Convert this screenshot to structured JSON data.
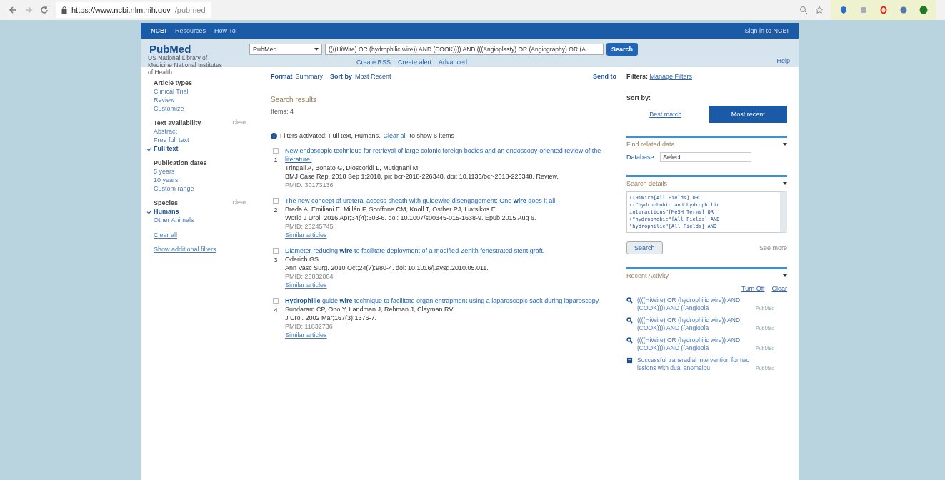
{
  "browser": {
    "url_host": "https://www.ncbi.nlm.nih.gov",
    "url_path": "/pubmed"
  },
  "ncbi_bar": {
    "brand": "NCBI",
    "links": [
      "Resources",
      "How To"
    ],
    "sign_in": "Sign in to NCBI"
  },
  "header": {
    "logo": "PubMed",
    "logo_sub": "US National Library of Medicine National Institutes of Health",
    "database": "PubMed",
    "query": "((((HiWire) OR (hydrophilic wire)) AND (COOK)))) AND (((Angioplasty) OR (Angiography) OR (A",
    "search_button": "Search",
    "links": [
      "Create RSS",
      "Create alert",
      "Advanced"
    ],
    "help": "Help"
  },
  "sidebar": {
    "groups": [
      {
        "title": "Article types",
        "items": [
          {
            "label": "Clinical Trial",
            "checked": false
          },
          {
            "label": "Review",
            "checked": false
          },
          {
            "label": "Customize",
            "checked": false
          }
        ]
      },
      {
        "title": "Text availability",
        "clear": "clear",
        "items": [
          {
            "label": "Abstract",
            "checked": false
          },
          {
            "label": "Free full text",
            "checked": false
          },
          {
            "label": "Full text",
            "checked": true
          }
        ]
      },
      {
        "title": "Publication dates",
        "items": [
          {
            "label": "5 years",
            "checked": false
          },
          {
            "label": "10 years",
            "checked": false
          },
          {
            "label": "Custom range",
            "checked": false
          }
        ]
      },
      {
        "title": "Species",
        "clear": "clear",
        "items": [
          {
            "label": "Humans",
            "checked": true
          },
          {
            "label": "Other Animals",
            "checked": false
          }
        ]
      }
    ],
    "links": [
      "Clear all",
      "Show additional filters"
    ]
  },
  "toolbar": {
    "format_label": "Format",
    "format": "Summary",
    "sort_label": "Sort by",
    "sort": "Most Recent",
    "send_to": "Send to"
  },
  "results": {
    "title": "Search results",
    "count": "Items: 4",
    "notice": "Filters activated: Full text, Humans.",
    "notice_link": "Clear all",
    "notice_tail": "to show 6 items",
    "items": [
      {
        "number": "1",
        "checked": false,
        "title": "New endoscopic technique for retrieval of large colonic foreign bodies and an endoscopy-oriented review of the literature.",
        "authors": "Tringali A, Bonato G, Dioscoridi L, Mutignani M.",
        "citation": "BMJ Case Rep. 2018 Sep 1;2018. pii: bcr-2018-226348. doi: 10.1136/bcr-2018-226348. Review.",
        "pmid": "PMID: 30173136"
      },
      {
        "number": "2",
        "checked": false,
        "title": "The new concept of ureteral access sheath with guidewire disengagement: One **wire** does it all.",
        "authors": "Breda A, Emiliani E, Millán F, Scoffone CM, Knoll T, Osther PJ, Liatsikos E.",
        "citation": "World J Urol. 2016 Apr;34(4):603-6. doi: 10.1007/s00345-015-1638-9. Epub 2015 Aug 6.",
        "pmid": "PMID: 26245745",
        "similar": "Similar articles"
      },
      {
        "number": "3",
        "checked": false,
        "title": "Diameter-reducing **wire** to facilitate deployment of a modified Zenith fenestrated stent graft.",
        "authors": "Oderich GS.",
        "citation": "Ann Vasc Surg. 2010 Oct;24(7):980-4. doi: 10.1016/j.avsg.2010.05.011.",
        "pmid": "PMID: 20832004",
        "similar": "Similar articles"
      },
      {
        "number": "4",
        "checked": false,
        "title": "**Hydrophilic** guide **wire** technique to facilitate organ entrapment using a laparoscopic sack during laparoscopy.",
        "authors": "Sundaram CP, Ono Y, Landman J, Rehman J, Clayman RV.",
        "citation": "J Urol. 2002 Mar;167(3):1376-7.",
        "pmid": "PMID: 11832736",
        "similar": "Similar articles"
      }
    ]
  },
  "right": {
    "filters_label": "Filters:",
    "filters_link": "Manage Filters",
    "sort_label": "Sort by:",
    "sort_options": [
      {
        "label": "Best match",
        "selected": false
      },
      {
        "label": "Most recent",
        "selected": true
      }
    ],
    "related": {
      "title": "Find related data",
      "db_label": "Database:",
      "db_value": "Select"
    },
    "details": {
      "title": "Search details",
      "lines": [
        "((HiWire[All Fields] OR",
        "((\"hydrophobic and hydrophilic",
        "interactions\"[MeSH Terms] OR",
        "(\"hydrophobic\"[All Fields] AND",
        "\"hydrophilic\"[All Fields] AND"
      ],
      "button": "Search",
      "see_more": "See more"
    },
    "recent": {
      "title": "Recent Activity",
      "turn_off": "Turn Off",
      "clear": "Clear",
      "items": [
        {
          "kind": "search",
          "text": "((((HiWire) OR (hydrophilic wire)) AND (COOK)))) AND ((Angiopla",
          "source": "PubMed"
        },
        {
          "kind": "search",
          "text": "((((HiWire) OR (hydrophilic wire)) AND (COOK)))) AND ((Angiopla",
          "source": "PubMed"
        },
        {
          "kind": "search",
          "text": "((((HiWire) OR (hydrophilic wire)) AND (COOK)))) AND ((Angiopla",
          "source": "PubMed"
        },
        {
          "kind": "article",
          "text": "Successful transradial intervention for two lesions with dual anomalou",
          "source": "PubMed"
        }
      ]
    }
  }
}
